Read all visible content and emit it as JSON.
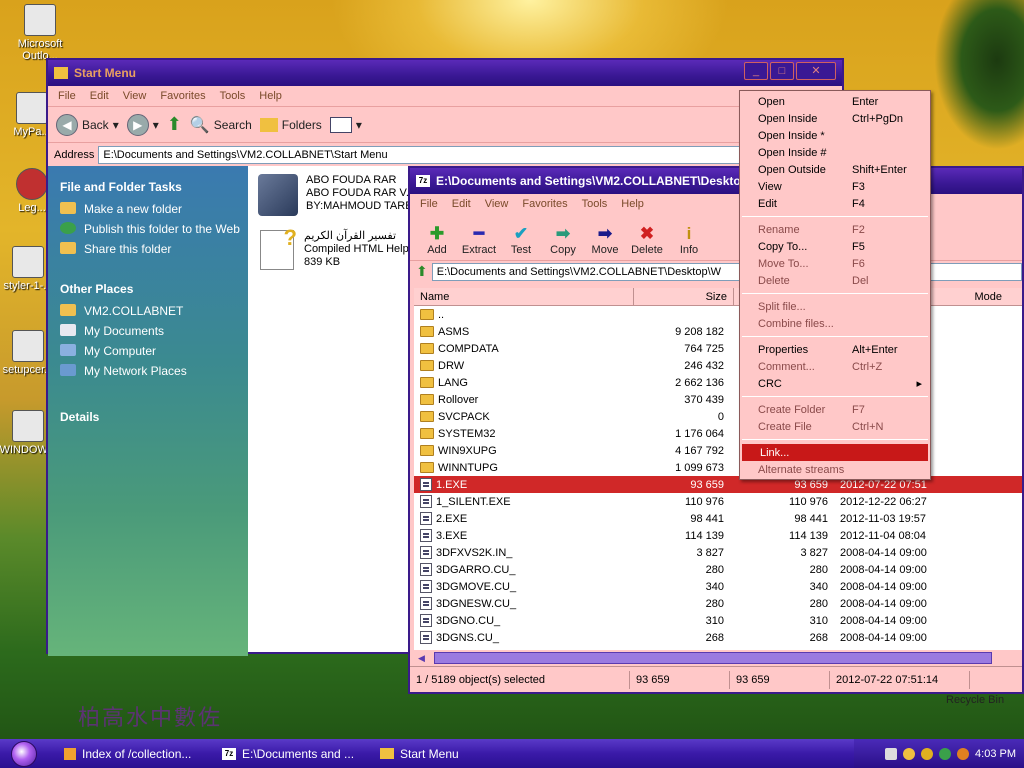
{
  "desktop": {
    "icons": [
      "Microsoft Outlo...",
      "MyPa...",
      "Leg...",
      "styler-1-...",
      "setupcer...",
      "WINDOW..."
    ],
    "recycle_bin": "Recycle Bin"
  },
  "explorer": {
    "title": "Start Menu",
    "menu": [
      "File",
      "Edit",
      "View",
      "Favorites",
      "Tools",
      "Help"
    ],
    "toolbar": {
      "back": "Back",
      "search": "Search",
      "folders": "Folders"
    },
    "address_label": "Address",
    "address_value": "E:\\Documents and Settings\\VM2.COLLABNET\\Start Menu",
    "tasks": {
      "file_folder_title": "File and Folder Tasks",
      "file_folder_items": [
        "Make a new folder",
        "Publish this folder to the Web",
        "Share this folder"
      ],
      "other_places_title": "Other Places",
      "other_places_items": [
        "VM2.COLLABNET",
        "My Documents",
        "My Computer",
        "My Network Places"
      ],
      "details_title": "Details"
    },
    "files": [
      {
        "line1": "ABO FOUDA RAR",
        "line2": "ABO FOUDA RAR V.1",
        "line3": "BY:MAHMOUD TAREK"
      },
      {
        "line1": "تفسير القرآن الكريم",
        "line2": "Compiled HTML Help",
        "line3": "839 KB"
      }
    ]
  },
  "sevenzip": {
    "title": "E:\\Documents and Settings\\VM2.COLLABNET\\Desktop\\",
    "menu": [
      "File",
      "Edit",
      "View",
      "Favorites",
      "Tools",
      "Help"
    ],
    "tools": [
      "Add",
      "Extract",
      "Test",
      "Copy",
      "Move",
      "Delete",
      "Info"
    ],
    "address": "E:\\Documents and Settings\\VM2.COLLABNET\\Desktop\\W",
    "columns": {
      "name": "Name",
      "size": "Size",
      "mode": "Mode"
    },
    "rows": [
      {
        "name": "..",
        "size": "",
        "packed": "",
        "modified": "",
        "type": "folder"
      },
      {
        "name": "ASMS",
        "size": "9 208 182",
        "packed": "",
        "modified": "",
        "type": "folder"
      },
      {
        "name": "COMPDATA",
        "size": "764 725",
        "packed": "",
        "modified": "",
        "type": "folder"
      },
      {
        "name": "DRW",
        "size": "246 432",
        "packed": "",
        "modified": "",
        "type": "folder"
      },
      {
        "name": "LANG",
        "size": "2 662 136",
        "packed": "",
        "modified": "",
        "type": "folder"
      },
      {
        "name": "Rollover",
        "size": "370 439",
        "packed": "",
        "modified": "",
        "type": "folder"
      },
      {
        "name": "SVCPACK",
        "size": "0",
        "packed": "",
        "modified": "",
        "type": "folder"
      },
      {
        "name": "SYSTEM32",
        "size": "1 176 064",
        "packed": "",
        "modified": "",
        "type": "folder"
      },
      {
        "name": "WIN9XUPG",
        "size": "4 167 792",
        "packed": "",
        "modified": "",
        "type": "folder"
      },
      {
        "name": "WINNTUPG",
        "size": "1 099 673",
        "packed": "",
        "modified": "",
        "type": "folder"
      },
      {
        "name": "1.EXE",
        "size": "93 659",
        "packed": "93 659",
        "modified": "2012-07-22 07:51",
        "type": "file",
        "selected": true
      },
      {
        "name": "1_SILENT.EXE",
        "size": "110 976",
        "packed": "110 976",
        "modified": "2012-12-22 06:27",
        "type": "file"
      },
      {
        "name": "2.EXE",
        "size": "98 441",
        "packed": "98 441",
        "modified": "2012-11-03 19:57",
        "type": "file"
      },
      {
        "name": "3.EXE",
        "size": "114 139",
        "packed": "114 139",
        "modified": "2012-11-04 08:04",
        "type": "file"
      },
      {
        "name": "3DFXVS2K.IN_",
        "size": "3 827",
        "packed": "3 827",
        "modified": "2008-04-14 09:00",
        "type": "file"
      },
      {
        "name": "3DGARRO.CU_",
        "size": "280",
        "packed": "280",
        "modified": "2008-04-14 09:00",
        "type": "file"
      },
      {
        "name": "3DGMOVE.CU_",
        "size": "340",
        "packed": "340",
        "modified": "2008-04-14 09:00",
        "type": "file"
      },
      {
        "name": "3DGNESW.CU_",
        "size": "280",
        "packed": "280",
        "modified": "2008-04-14 09:00",
        "type": "file"
      },
      {
        "name": "3DGNO.CU_",
        "size": "310",
        "packed": "310",
        "modified": "2008-04-14 09:00",
        "type": "file"
      },
      {
        "name": "3DGNS.CU_",
        "size": "268",
        "packed": "268",
        "modified": "2008-04-14 09:00",
        "type": "file"
      }
    ],
    "status": [
      "1 / 5189 object(s) selected",
      "93 659",
      "93 659",
      "2012-07-22 07:51:14"
    ]
  },
  "context_menu": [
    {
      "label": "Open",
      "key": "Enter"
    },
    {
      "label": "Open Inside",
      "key": "Ctrl+PgDn"
    },
    {
      "label": "Open Inside *",
      "key": ""
    },
    {
      "label": "Open Inside #",
      "key": ""
    },
    {
      "label": "Open Outside",
      "key": "Shift+Enter"
    },
    {
      "label": "View",
      "key": "F3"
    },
    {
      "label": "Edit",
      "key": "F4"
    },
    {
      "sep": true
    },
    {
      "label": "Rename",
      "key": "F2",
      "disabled": true
    },
    {
      "label": "Copy To...",
      "key": "F5"
    },
    {
      "label": "Move To...",
      "key": "F6",
      "disabled": true
    },
    {
      "label": "Delete",
      "key": "Del",
      "disabled": true
    },
    {
      "sep": true
    },
    {
      "label": "Split file...",
      "key": "",
      "disabled": true
    },
    {
      "label": "Combine files...",
      "key": "",
      "disabled": true
    },
    {
      "sep": true
    },
    {
      "label": "Properties",
      "key": "Alt+Enter"
    },
    {
      "label": "Comment...",
      "key": "Ctrl+Z",
      "disabled": true
    },
    {
      "label": "CRC",
      "key": "",
      "submenu": true
    },
    {
      "sep": true
    },
    {
      "label": "Create Folder",
      "key": "F7",
      "disabled": true
    },
    {
      "label": "Create File",
      "key": "Ctrl+N",
      "disabled": true
    },
    {
      "sep": true
    },
    {
      "label": "Link...",
      "key": "",
      "highlighted": true
    },
    {
      "label": "Alternate streams",
      "key": "",
      "disabled": true
    }
  ],
  "taskbar": {
    "items": [
      "Index of /collection...",
      "E:\\Documents and ...",
      "Start Menu"
    ],
    "clock": "4:03 PM"
  },
  "watermark_text": "柏高水中數佐"
}
